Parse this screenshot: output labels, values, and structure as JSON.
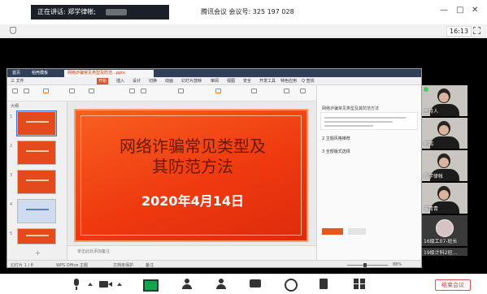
{
  "topbar": {
    "speaking_label": "正在讲话: 郑学律帐;",
    "meeting_title": "腾讯会议 会议号: 325 197 028",
    "minimize": "—",
    "maximize": "□",
    "close": "✕"
  },
  "subbar": {
    "timer": "16:13",
    "fullscreen": ""
  },
  "wps": {
    "tabs": [
      "首页",
      "稻壳模板",
      "网络诈骗常见类型及防范...pptx"
    ],
    "ribbon_menu": [
      "三 文件",
      "开始",
      "插入",
      "设计",
      "切换",
      "动画",
      "幻灯片放映",
      "审阅",
      "视图",
      "安全",
      "开发工具",
      "特色应用",
      "Q 查找"
    ],
    "thumbs_header": "大纲",
    "thumb_numbers": [
      "1",
      "2",
      "3",
      "4",
      "5"
    ],
    "add_slide": "+",
    "slide_title_line1": "网络诈骗常见类型及",
    "slide_title_line2": "其防范方法",
    "slide_date": "2020年4月14日",
    "notes_label": "单击此处添加备注",
    "right_pane": {
      "title": "网络诈骗常见类型及其防范方法",
      "item1": "2 主题风格推荐",
      "item2": "3 全部版式选择",
      "btn_primary": "",
      "btn_secondary": ""
    },
    "status": {
      "slide_count": "幻灯片 1 / 8",
      "theme": "WPS Office 主题",
      "proofing": "文档未保护",
      "notes": "备注",
      "zoom": "88%"
    }
  },
  "videos": [
    {
      "name": "主持人"
    },
    {
      "name": "何鹏"
    },
    {
      "name": "郑学律帐"
    },
    {
      "name": "王青青"
    },
    {
      "name": "16级工07-班长"
    },
    {
      "name": "19级计科2班..."
    }
  ],
  "toolbar": {
    "end_meeting": "结束会议"
  }
}
